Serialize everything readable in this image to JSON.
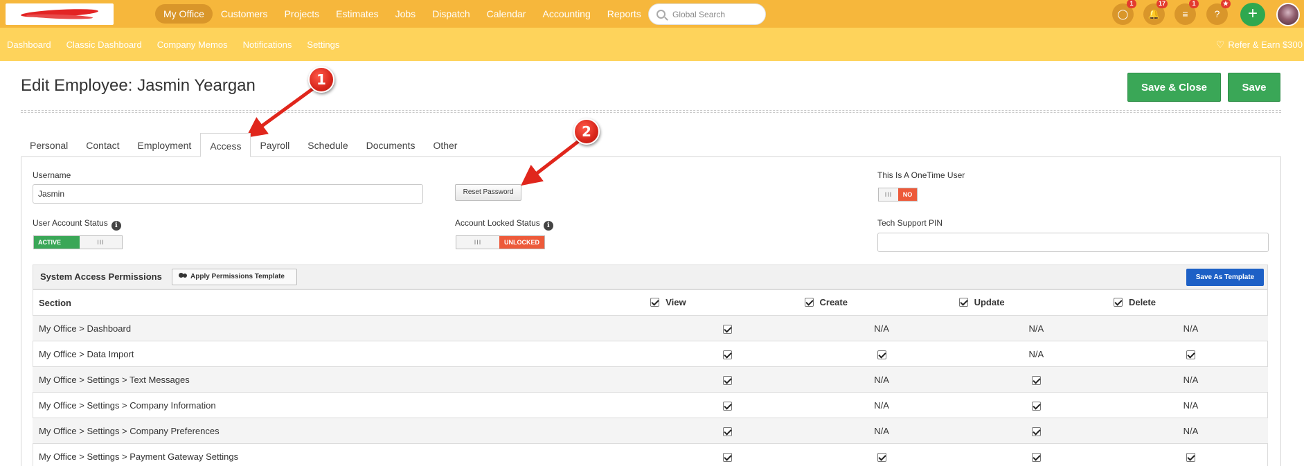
{
  "topbar": {
    "nav": [
      "My Office",
      "Customers",
      "Projects",
      "Estimates",
      "Jobs",
      "Dispatch",
      "Calendar",
      "Accounting",
      "Reports"
    ],
    "active_nav": "My Office",
    "search_placeholder": "Global Search",
    "icons": [
      {
        "name": "chat-icon",
        "glyph": "◯",
        "badge": "1"
      },
      {
        "name": "bell-icon",
        "glyph": "🔔",
        "badge": "17"
      },
      {
        "name": "list-icon",
        "glyph": "≡",
        "badge": "1"
      },
      {
        "name": "help-icon",
        "glyph": "?",
        "badge": "★"
      }
    ],
    "plus": "+"
  },
  "subbar": {
    "items": [
      "Dashboard",
      "Classic Dashboard",
      "Company Memos",
      "Notifications",
      "Settings"
    ],
    "refer": "Refer & Earn $300"
  },
  "page": {
    "title": "Edit Employee: Jasmin Yeargan",
    "save_close": "Save & Close",
    "save": "Save"
  },
  "tabs": [
    "Personal",
    "Contact",
    "Employment",
    "Access",
    "Payroll",
    "Schedule",
    "Documents",
    "Other"
  ],
  "active_tab": "Access",
  "access": {
    "username_label": "Username",
    "username_value": "Jasmin",
    "reset_password": "Reset Password",
    "onetime_label": "This Is A OneTime User",
    "onetime_state": "NO",
    "account_status_label": "User Account Status",
    "account_status_state": "ACTIVE",
    "locked_label": "Account Locked Status",
    "locked_state": "UNLOCKED",
    "pin_label": "Tech Support PIN",
    "pin_value": "",
    "toggle_grip": "III",
    "info_glyph": "i"
  },
  "permissions": {
    "title": "System Access Permissions",
    "apply_template": "Apply Permissions Template",
    "save_template": "Save As Template",
    "columns": [
      "Section",
      "View",
      "Create",
      "Update",
      "Delete"
    ],
    "rows": [
      {
        "section": "My Office > Dashboard",
        "view": true,
        "create": "N/A",
        "update": "N/A",
        "delete": "N/A"
      },
      {
        "section": "My Office > Data Import",
        "view": true,
        "create": true,
        "update": "N/A",
        "delete": true
      },
      {
        "section": "My Office > Settings > Text Messages",
        "view": true,
        "create": "N/A",
        "update": true,
        "delete": "N/A"
      },
      {
        "section": "My Office > Settings > Company Information",
        "view": true,
        "create": "N/A",
        "update": true,
        "delete": "N/A"
      },
      {
        "section": "My Office > Settings > Company Preferences",
        "view": true,
        "create": "N/A",
        "update": true,
        "delete": "N/A"
      },
      {
        "section": "My Office > Settings > Payment Gateway Settings",
        "view": true,
        "create": true,
        "update": true,
        "delete": true
      }
    ]
  },
  "annotations": [
    "1",
    "2"
  ],
  "colors": {
    "topbar": "#f6b73c",
    "subbar": "#fed35b",
    "green": "#3aa757",
    "blue": "#1d60c6",
    "red": "#ed5a3a",
    "annotation_red": "#d8261b"
  }
}
